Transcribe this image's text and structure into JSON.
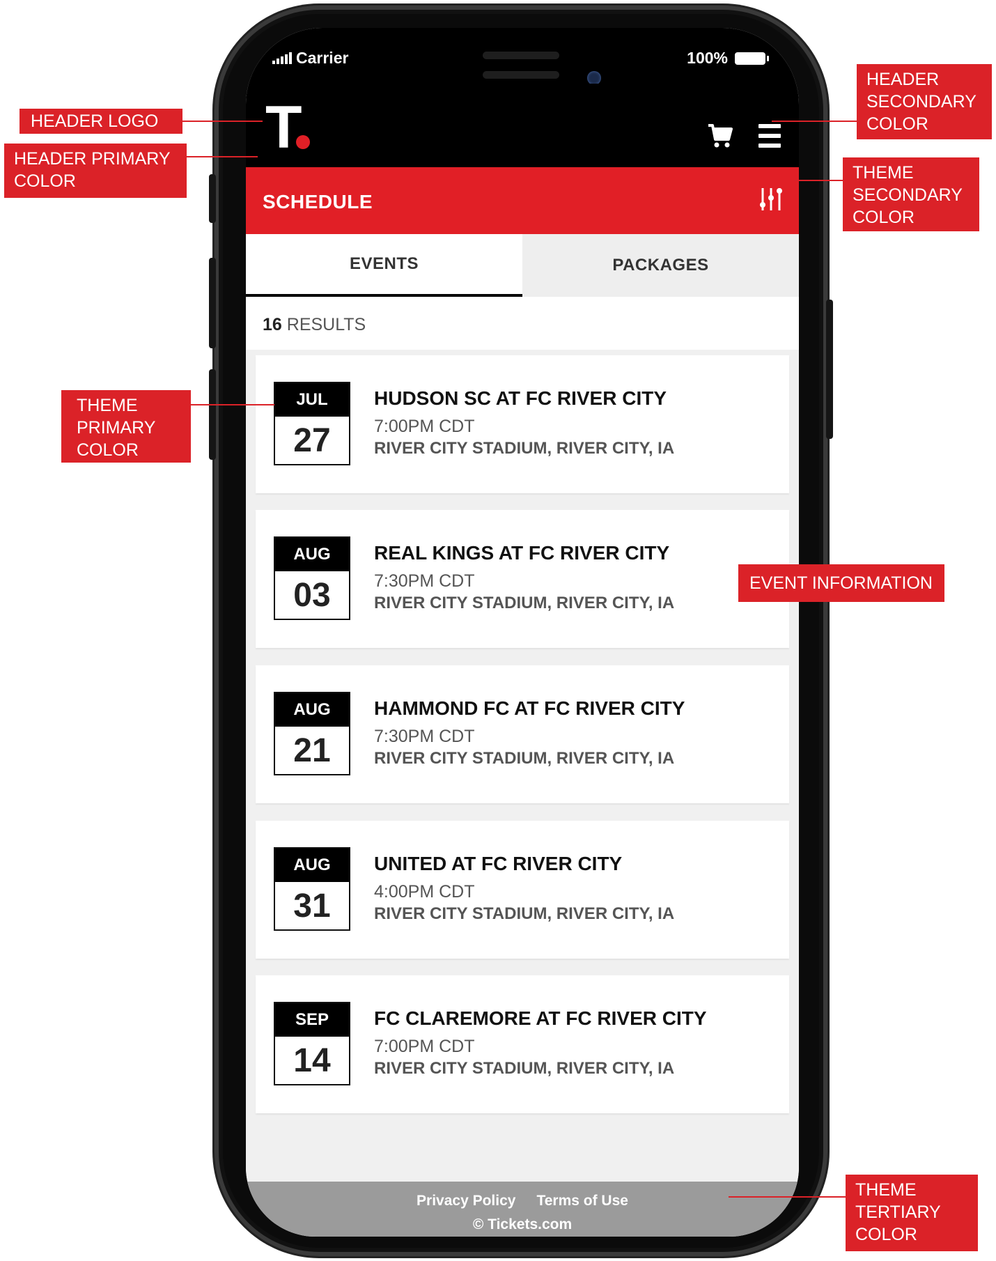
{
  "status_bar": {
    "carrier": "Carrier",
    "battery": "100%"
  },
  "header": {
    "logo_letter": "T"
  },
  "schedule": {
    "title": "SCHEDULE"
  },
  "tabs": [
    {
      "label": "EVENTS",
      "active": true
    },
    {
      "label": "PACKAGES",
      "active": false
    }
  ],
  "results": {
    "count": "16",
    "label": "RESULTS"
  },
  "events": [
    {
      "month": "JUL",
      "day": "27",
      "title": "HUDSON SC AT FC RIVER CITY",
      "time": "7:00PM CDT",
      "venue": "RIVER CITY STADIUM, RIVER CITY, IA"
    },
    {
      "month": "AUG",
      "day": "03",
      "title": "REAL KINGS AT FC RIVER CITY",
      "time": "7:30PM CDT",
      "venue": "RIVER CITY STADIUM, RIVER CITY, IA"
    },
    {
      "month": "AUG",
      "day": "21",
      "title": "HAMMOND FC AT FC RIVER CITY",
      "time": "7:30PM CDT",
      "venue": "RIVER CITY STADIUM, RIVER CITY, IA"
    },
    {
      "month": "AUG",
      "day": "31",
      "title": "UNITED AT FC RIVER CITY",
      "time": "4:00PM CDT",
      "venue": "RIVER CITY STADIUM, RIVER CITY, IA"
    },
    {
      "month": "SEP",
      "day": "14",
      "title": "FC CLAREMORE AT FC RIVER CITY",
      "time": "7:00PM CDT",
      "venue": "RIVER CITY STADIUM, RIVER CITY, IA"
    }
  ],
  "footer": {
    "privacy": "Privacy Policy",
    "terms": "Terms of Use",
    "copyright": "© Tickets.com"
  },
  "annotations": {
    "header_logo": "HEADER LOGO",
    "header_primary": "HEADER PRIMARY\nCOLOR",
    "header_secondary": "HEADER\nSECONDARY\nCOLOR",
    "theme_secondary": "THEME\nSECONDARY\nCOLOR",
    "theme_primary": "THEME\nPRIMARY\nCOLOR",
    "event_information": "EVENT INFORMATION",
    "theme_tertiary": "THEME\nTERTIARY\nCOLOR"
  },
  "colors": {
    "accent": "#e11f26",
    "header_bg": "#000000",
    "footer_bg": "#9b9b9b",
    "annotation": "#db2228"
  },
  "icons": [
    "signal-icon",
    "battery-icon",
    "cart-icon",
    "hamburger-menu-icon",
    "filter-sliders-icon"
  ]
}
